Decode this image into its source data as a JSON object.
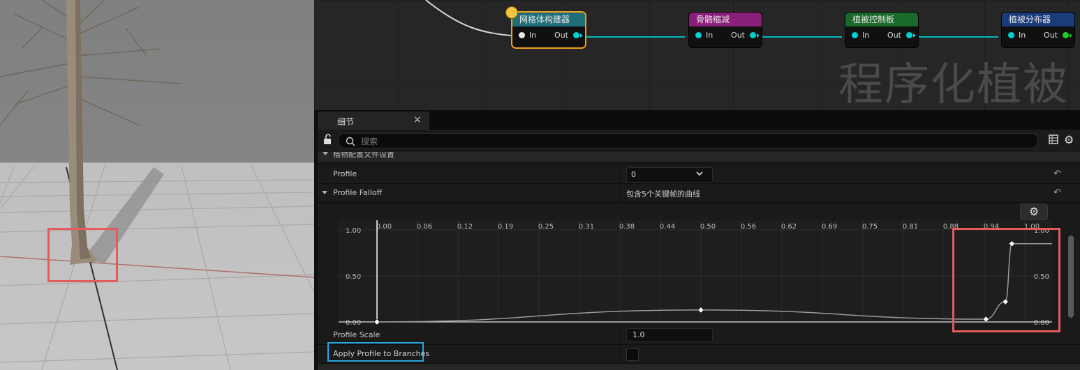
{
  "graph": {
    "watermark": "程序化植被",
    "nodes": [
      {
        "title": "网格体构建器",
        "in": "In",
        "out": "Out",
        "header_color": "#1f6e78",
        "selected": true
      },
      {
        "title": "骨骼缩减",
        "in": "In",
        "out": "Out",
        "header_color": "#8a1f7a"
      },
      {
        "title": "植被控制板",
        "in": "In",
        "out": "Out",
        "header_color": "#1a6a2a"
      },
      {
        "title": "植被分布器",
        "in": "In",
        "out": "Out",
        "header_color": "#1a3c7a"
      }
    ]
  },
  "details": {
    "tab_label": "细节",
    "tab_close": "×",
    "search_placeholder": "搜索",
    "category_label": "植物配置文件设置",
    "rows": {
      "profile": {
        "name": "Profile",
        "value": "0"
      },
      "profile_falloff": {
        "name": "Profile Falloff",
        "value": "包含5个关键帧的曲线"
      },
      "profile_scale": {
        "name": "Profile Scale",
        "value": "1.0"
      },
      "apply_profile": {
        "name": "Apply Profile to Branches",
        "checked": false
      }
    },
    "curve": {
      "x_ticks": [
        "0.00",
        "0.06",
        "0.12",
        "0.19",
        "0.25",
        "0.31",
        "0.38",
        "0.44",
        "0.50",
        "0.56",
        "0.62",
        "0.69",
        "0.75",
        "0.81",
        "0.88",
        "0.94",
        "1.00"
      ],
      "y_ticks_left": [
        "1.00",
        "0.50",
        "0.00"
      ],
      "y_ticks_right": [
        "1.00",
        "0.50",
        "0.00"
      ]
    }
  },
  "chart_data": {
    "type": "line",
    "title": "",
    "xlabel": "",
    "ylabel": "",
    "xlim": [
      0,
      1
    ],
    "ylim": [
      0,
      1
    ],
    "series": [
      {
        "values": [
          [
            0.0,
            0.0
          ],
          [
            0.5,
            0.13
          ],
          [
            0.94,
            0.03
          ],
          [
            0.97,
            0.22
          ],
          [
            0.98,
            0.85
          ]
        ]
      }
    ]
  }
}
